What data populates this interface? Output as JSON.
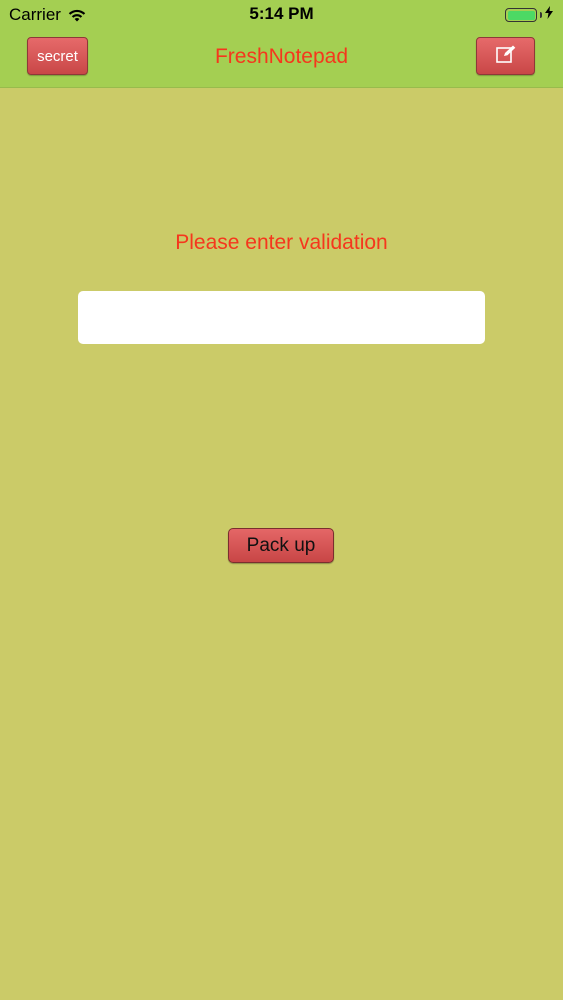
{
  "status_bar": {
    "carrier": "Carrier",
    "time": "5:14 PM",
    "wifi_icon": "wifi-icon",
    "battery_icon": "battery-icon",
    "charging_icon": "bolt-icon",
    "battery_level": 1.0
  },
  "nav_bar": {
    "secret_label": "secret",
    "title": "FreshNotepad",
    "compose_icon": "compose-icon"
  },
  "main": {
    "prompt": "Please enter validation",
    "validation_value": "",
    "validation_placeholder": "",
    "pack_up_label": "Pack up"
  },
  "colors": {
    "background": "#cbcb68",
    "nav_background": "#a4cf52",
    "accent_text": "#f5371d",
    "button": "#d65656",
    "battery_fill": "#4cd964"
  }
}
